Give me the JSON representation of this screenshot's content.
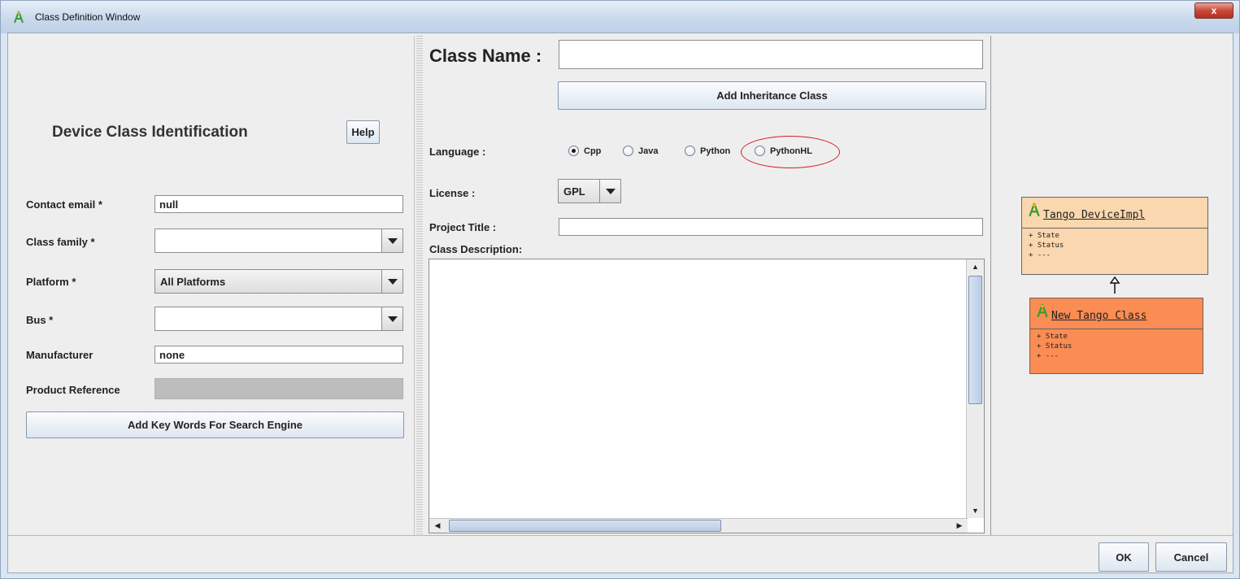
{
  "window": {
    "title": "Class Definition Window",
    "close_glyph": "x"
  },
  "left": {
    "heading": "Device Class Identification",
    "help_label": "Help",
    "contact_email_label": "Contact email *",
    "contact_email_value": "null",
    "class_family_label": "Class family *",
    "class_family_value": "",
    "platform_label": "Platform *",
    "platform_value": "All Platforms",
    "bus_label": "Bus *",
    "bus_value": "",
    "manufacturer_label": "Manufacturer",
    "manufacturer_value": "none",
    "product_reference_label": "Product Reference",
    "product_reference_value": "",
    "keywords_button": "Add Key Words For Search Engine"
  },
  "center": {
    "class_name_label": "Class Name :",
    "class_name_value": "",
    "inheritance_button": "Add Inheritance Class",
    "language_label": "Language :",
    "languages": [
      {
        "label": "Cpp",
        "selected": true
      },
      {
        "label": "Java",
        "selected": false
      },
      {
        "label": "Python",
        "selected": false
      },
      {
        "label": "PythonHL",
        "selected": false
      }
    ],
    "license_label": "License :",
    "license_value": "GPL",
    "project_title_label": "Project Title :",
    "project_title_value": "",
    "class_description_label": "Class Description:",
    "class_description_value": ""
  },
  "uml": {
    "parent": {
      "name": "Tango DeviceImpl",
      "attrs": [
        "+ State",
        "+ Status",
        "+ ---"
      ],
      "color": "#fad7ae"
    },
    "child": {
      "name": "New Tango Class",
      "attrs": [
        "+ State",
        "+ Status",
        "+ ---"
      ],
      "color": "#fb8c54"
    }
  },
  "footer": {
    "ok_label": "OK",
    "cancel_label": "Cancel"
  },
  "colors": {
    "highlight": "#d21e1e"
  }
}
